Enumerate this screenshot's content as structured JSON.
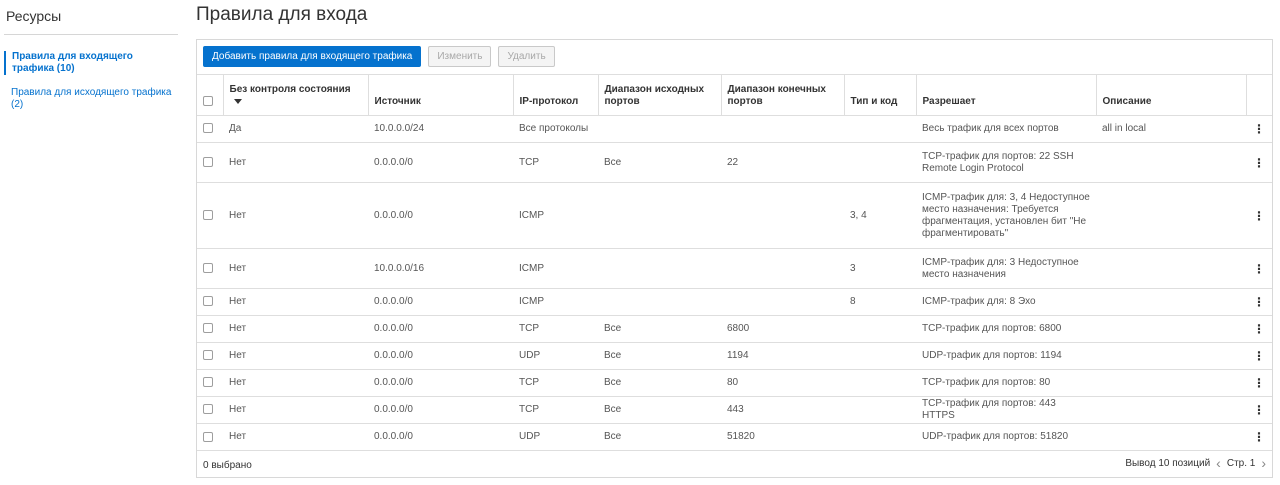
{
  "sidebar": {
    "title": "Ресурсы",
    "items": [
      {
        "label": "Правила для входящего трафика (10)",
        "active": true
      },
      {
        "label": "Правила для исходящего трафика (2)",
        "active": false
      }
    ]
  },
  "page": {
    "title": "Правила для входа"
  },
  "toolbar": {
    "add_label": "Добавить правила для входящего трафика",
    "edit_label": "Изменить",
    "delete_label": "Удалить"
  },
  "table": {
    "columns": [
      "Без контроля состояния",
      "Источник",
      "IP-протокол",
      "Диапазон исходных портов",
      "Диапазон конечных портов",
      "Тип и код",
      "Разрешает",
      "Описание"
    ],
    "rows": [
      {
        "stateless": "Да",
        "source": "10.0.0.0/24",
        "protocol": "Все протоколы",
        "src_ports": "",
        "dst_ports": "",
        "type_code": "",
        "allows": "Весь трафик для всех портов",
        "description": "all in local"
      },
      {
        "stateless": "Нет",
        "source": "0.0.0.0/0",
        "protocol": "TCP",
        "src_ports": "Все",
        "dst_ports": "22",
        "type_code": "",
        "allows": "TCP-трафик для портов: 22 SSH Remote Login Protocol",
        "description": ""
      },
      {
        "stateless": "Нет",
        "source": "0.0.0.0/0",
        "protocol": "ICMP",
        "src_ports": "",
        "dst_ports": "",
        "type_code": "3, 4",
        "allows": "ICMP-трафик для: 3, 4 Недоступное место назначения: Требуется фрагментация, установлен бит \"Не фрагментировать\"",
        "description": ""
      },
      {
        "stateless": "Нет",
        "source": "10.0.0.0/16",
        "protocol": "ICMP",
        "src_ports": "",
        "dst_ports": "",
        "type_code": "3",
        "allows": "ICMP-трафик для: 3 Недоступное место назначения",
        "description": ""
      },
      {
        "stateless": "Нет",
        "source": "0.0.0.0/0",
        "protocol": "ICMP",
        "src_ports": "",
        "dst_ports": "",
        "type_code": "8",
        "allows": "ICMP-трафик для: 8 Эхо",
        "description": ""
      },
      {
        "stateless": "Нет",
        "source": "0.0.0.0/0",
        "protocol": "TCP",
        "src_ports": "Все",
        "dst_ports": "6800",
        "type_code": "",
        "allows": "TCP-трафик для портов: 6800",
        "description": ""
      },
      {
        "stateless": "Нет",
        "source": "0.0.0.0/0",
        "protocol": "UDP",
        "src_ports": "Все",
        "dst_ports": "1194",
        "type_code": "",
        "allows": "UDP-трафик для портов: 1194",
        "description": ""
      },
      {
        "stateless": "Нет",
        "source": "0.0.0.0/0",
        "protocol": "TCP",
        "src_ports": "Все",
        "dst_ports": "80",
        "type_code": "",
        "allows": "TCP-трафик для портов: 80",
        "description": ""
      },
      {
        "stateless": "Нет",
        "source": "0.0.0.0/0",
        "protocol": "TCP",
        "src_ports": "Все",
        "dst_ports": "443",
        "type_code": "",
        "allows": "TCP-трафик для портов: 443 HTTPS",
        "description": ""
      },
      {
        "stateless": "Нет",
        "source": "0.0.0.0/0",
        "protocol": "UDP",
        "src_ports": "Все",
        "dst_ports": "51820",
        "type_code": "",
        "allows": "UDP-трафик для портов: 51820",
        "description": ""
      }
    ]
  },
  "footer": {
    "selected": "0 выбрано",
    "display": "Вывод 10 позиций",
    "page": "Стр. 1"
  },
  "colors": {
    "accent": "#0572ce"
  }
}
